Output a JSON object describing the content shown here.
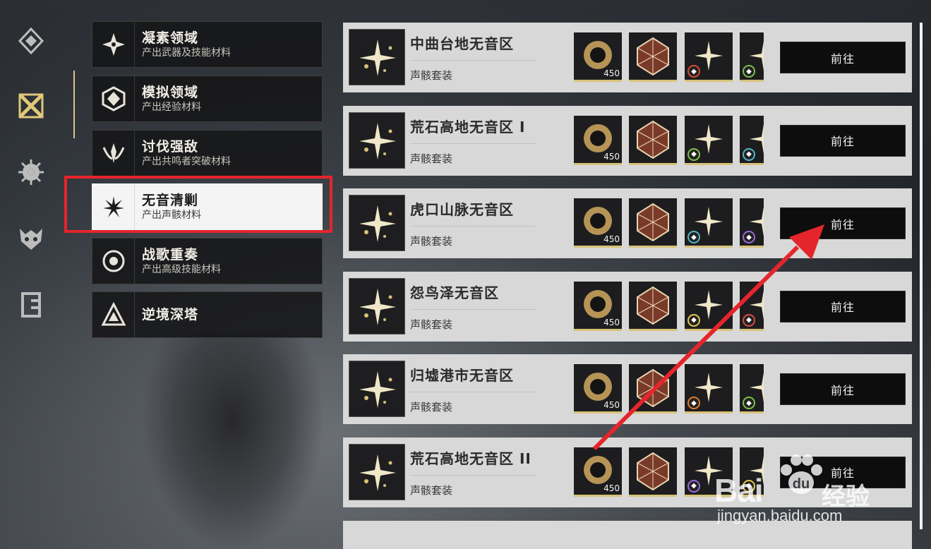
{
  "rail": {
    "icons": [
      "compass-diamond-icon",
      "crossed-swords-icon",
      "gear-snowflake-icon",
      "beast-mask-icon",
      "door-tower-icon"
    ]
  },
  "categories": [
    {
      "title": "凝素领域",
      "subtitle": "产出武器及技能材料",
      "icon": "crystal-cross-icon",
      "active": false
    },
    {
      "title": "模拟领域",
      "subtitle": "产出经验材料",
      "icon": "hex-shield-icon",
      "active": false
    },
    {
      "title": "讨伐强敌",
      "subtitle": "产出共鸣者突破材料",
      "icon": "winged-crest-icon",
      "active": false
    },
    {
      "title": "无音清剿",
      "subtitle": "产出声骸材料",
      "icon": "spike-burst-icon",
      "active": true
    },
    {
      "title": "战歌重奏",
      "subtitle": "产出高级技能材料",
      "icon": "ring-eye-icon",
      "active": false
    },
    {
      "title": "逆境深塔",
      "subtitle": "",
      "icon": "triangle-tower-icon",
      "active": false
    }
  ],
  "rows": [
    {
      "name": "中曲台地无音区",
      "sub": "声骸套装",
      "count": "450",
      "badges": [
        "red",
        "green"
      ],
      "button": "前往"
    },
    {
      "name": "荒石高地无音区 I",
      "sub": "声骸套装",
      "count": "450",
      "badges": [
        "green",
        "teal"
      ],
      "button": "前往"
    },
    {
      "name": "虎口山脉无音区",
      "sub": "声骸套装",
      "count": "450",
      "badges": [
        "teal",
        "purple"
      ],
      "button": "前往"
    },
    {
      "name": "怨鸟泽无音区",
      "sub": "声骸套装",
      "count": "450",
      "badges": [
        "yellow",
        "red"
      ],
      "button": "前往"
    },
    {
      "name": "归墟港市无音区",
      "sub": "声骸套装",
      "count": "450",
      "badges": [
        "orange",
        "green"
      ],
      "button": "前往"
    },
    {
      "name": "荒石高地无音区 II",
      "sub": "声骸套装",
      "count": "450",
      "badges": [
        "purple",
        "yellow"
      ],
      "button": "前往"
    }
  ],
  "colors": {
    "accent": "#d9c48a",
    "highlight": "#e5252c",
    "badge": {
      "red": "#d94a3a",
      "green": "#7cc04a",
      "teal": "#4fb6c6",
      "purple": "#9a6ad8",
      "yellow": "#e2c64a",
      "orange": "#e07a2a"
    }
  },
  "watermark": {
    "brand": "Bai",
    "suffix": "经验",
    "url": "jingyan.baidu.com"
  }
}
